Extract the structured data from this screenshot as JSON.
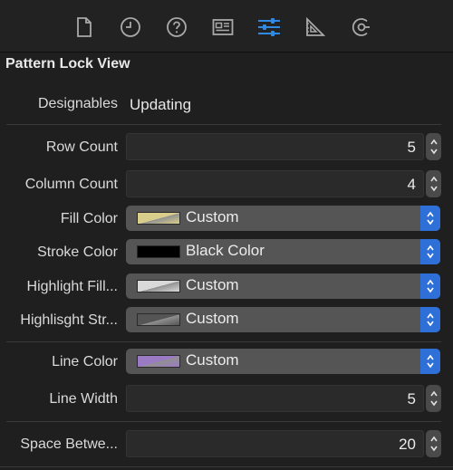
{
  "toolbar": {
    "icons": [
      {
        "name": "file-inspector-icon",
        "selected": false
      },
      {
        "name": "history-inspector-icon",
        "selected": false
      },
      {
        "name": "quick-help-icon",
        "selected": false
      },
      {
        "name": "identity-inspector-icon",
        "selected": false
      },
      {
        "name": "attributes-inspector-icon",
        "selected": true
      },
      {
        "name": "size-inspector-icon",
        "selected": false
      },
      {
        "name": "connections-inspector-icon",
        "selected": false
      }
    ],
    "selected_color": "#2f8ae6"
  },
  "section": {
    "title": "Pattern Lock View"
  },
  "designables": {
    "label": "Designables",
    "value": "Updating"
  },
  "rows": {
    "row_count": {
      "label": "Row Count",
      "value": "5"
    },
    "column_count": {
      "label": "Column Count",
      "value": "4"
    },
    "fill_color": {
      "label": "Fill Color",
      "value": "Custom",
      "swatch": "#d8cd8a"
    },
    "stroke_color": {
      "label": "Stroke Color",
      "value": "Black Color",
      "swatch": "#000000"
    },
    "highlight_fill": {
      "label": "Highlight Fill...",
      "value": "Custom",
      "swatch": "#d9d9d9"
    },
    "highlight_stroke": {
      "label": "Highlisght Str...",
      "value": "Custom",
      "swatch": "#555555"
    },
    "line_color": {
      "label": "Line Color",
      "value": "Custom",
      "swatch": "#9a7bc3"
    },
    "line_width": {
      "label": "Line Width",
      "value": "5"
    },
    "space_between": {
      "label": "Space Betwe...",
      "value": "20"
    }
  }
}
